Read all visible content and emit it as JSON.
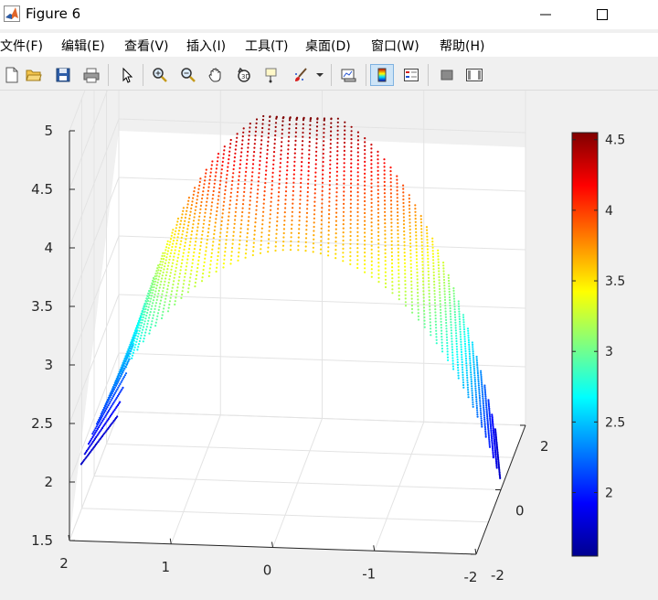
{
  "window": {
    "title": "Figure 6",
    "controls": {
      "minimize": "minimize",
      "maximize": "maximize"
    }
  },
  "menu": {
    "items": [
      {
        "name": "menu-file",
        "label": "文件(F)"
      },
      {
        "name": "menu-edit",
        "label": "编辑(E)"
      },
      {
        "name": "menu-view",
        "label": "查看(V)"
      },
      {
        "name": "menu-insert",
        "label": "插入(I)"
      },
      {
        "name": "menu-tools",
        "label": "工具(T)"
      },
      {
        "name": "menu-desktop",
        "label": "桌面(D)"
      },
      {
        "name": "menu-window",
        "label": "窗口(W)"
      },
      {
        "name": "menu-help",
        "label": "帮助(H)"
      }
    ]
  },
  "toolbar": {
    "buttons": [
      "new-figure-icon",
      "open-file-icon",
      "save-icon",
      "print-icon",
      "select-arrow-icon",
      "zoom-in-icon",
      "zoom-out-icon",
      "pan-hand-icon",
      "rotate-3d-icon",
      "data-cursor-icon",
      "brush-icon",
      "brush-dropdown-icon",
      "link-plot-icon",
      "colorbar-icon",
      "legend-icon",
      "hide-plot-tools-icon",
      "show-plot-tools-icon"
    ],
    "active": "colorbar-icon"
  },
  "chart_data": {
    "type": "scatter3",
    "title": "",
    "x_ticks": [
      "2",
      "1",
      "0",
      "-1",
      "-2"
    ],
    "y_ticks": [
      "-2",
      "0",
      "2"
    ],
    "z_ticks": [
      "1.5",
      "2",
      "2.5",
      "3",
      "3.5",
      "4",
      "4.5",
      "5"
    ],
    "xlim": [
      -2,
      2
    ],
    "ylim": [
      -2,
      2
    ],
    "zlim": [
      1.5,
      5
    ],
    "grid": true,
    "colormap": "jet",
    "colorbar": {
      "location": "right",
      "range": [
        1.55,
        4.55
      ],
      "ticks": [
        "2",
        "2.5",
        "3",
        "3.5",
        "4",
        "4.5"
      ]
    },
    "surface": {
      "z_range": [
        1.55,
        4.55
      ],
      "u_points": 70,
      "v_points": 35
    }
  }
}
